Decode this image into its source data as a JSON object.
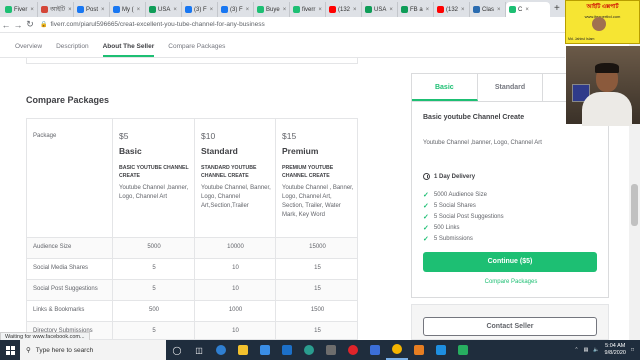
{
  "browser": {
    "tabs": [
      {
        "label": "Fiver",
        "color": "#1dbf73"
      },
      {
        "label": "আইটি",
        "color": "#d44638"
      },
      {
        "label": "Post",
        "color": "#1877f2"
      },
      {
        "label": "My (",
        "color": "#1877f2"
      },
      {
        "label": "USA",
        "color": "#0f9d58"
      },
      {
        "label": "(3) F",
        "color": "#1877f2"
      },
      {
        "label": "(3) F",
        "color": "#1877f2"
      },
      {
        "label": "Buye",
        "color": "#1dbf73"
      },
      {
        "label": "fiverr",
        "color": "#1dbf73"
      },
      {
        "label": "(132",
        "color": "#ff0000"
      },
      {
        "label": "USA",
        "color": "#0f9d58"
      },
      {
        "label": "FB a",
        "color": "#0f9d58"
      },
      {
        "label": "(132",
        "color": "#ff0000"
      },
      {
        "label": "Clas",
        "color": "#2b6cb0"
      },
      {
        "label": "C",
        "color": "#1dbf73",
        "active": true
      }
    ],
    "new_tab": "+",
    "url": "fiverr.com/piarul596665/creat-excellent-you-tube-channel-for-any-business"
  },
  "page_nav": {
    "items": [
      {
        "label": "Overview"
      },
      {
        "label": "Description"
      },
      {
        "label": "About The Seller",
        "active": true
      },
      {
        "label": "Compare Packages"
      }
    ]
  },
  "compare": {
    "title": "Compare Packages",
    "package_label": "Package",
    "packages": [
      {
        "price": "$5",
        "name": "Basic",
        "title": "BASIC YOUTUBE CHANNEL CREATE",
        "desc": "Youtube Channel ,banner, Logo, Channel Art"
      },
      {
        "price": "$10",
        "name": "Standard",
        "title": "STANDARD YOUTUBE CHANNEL CREATE",
        "desc": "Youtube Channel, Banner, Logo, Channel Art,Section,Trailer"
      },
      {
        "price": "$15",
        "name": "Premium",
        "title": "PREMIUM YOUTUBE CHANNEL CREATE",
        "desc": "Youtube Channel , Banner, Logo, Channel Art, Section, Trailer, Water Mark, Key Word"
      }
    ],
    "rows": [
      {
        "label": "Audience Size",
        "values": [
          "5000",
          "10000",
          "15000"
        ]
      },
      {
        "label": "Social Media Shares",
        "values": [
          "5",
          "10",
          "15"
        ]
      },
      {
        "label": "Social Post Suggestions",
        "values": [
          "5",
          "10",
          "15"
        ]
      },
      {
        "label": "Links & Bookmarks",
        "values": [
          "500",
          "1000",
          "1500"
        ]
      },
      {
        "label": "Directory Submissions",
        "values": [
          "5",
          "10",
          "15"
        ]
      }
    ]
  },
  "sidebar": {
    "tabs": [
      "Basic",
      "Standard",
      "Pr"
    ],
    "title": "Basic youtube Channel Create",
    "desc": "Youtube Channel ,banner, Logo, Channel Art",
    "delivery": "1 Day Delivery",
    "features": [
      "5000 Audience Size",
      "5 Social Shares",
      "5 Social Post Suggestions",
      "500 Links",
      "5 Submissions"
    ],
    "continue_label": "Continue ($5)",
    "compare_link": "Compare Packages",
    "contact_label": "Contact Seller"
  },
  "status_text": "Waiting for www.facebook.com...",
  "overlay_ad": {
    "line1": "আইটি এক্সপার্ট",
    "line2": "www.itexpertbd.com",
    "line3": "Md. Jahirul Islam"
  },
  "taskbar": {
    "search_placeholder": "Type here to search",
    "time": "5:04 AM",
    "date": "9/8/2020"
  }
}
